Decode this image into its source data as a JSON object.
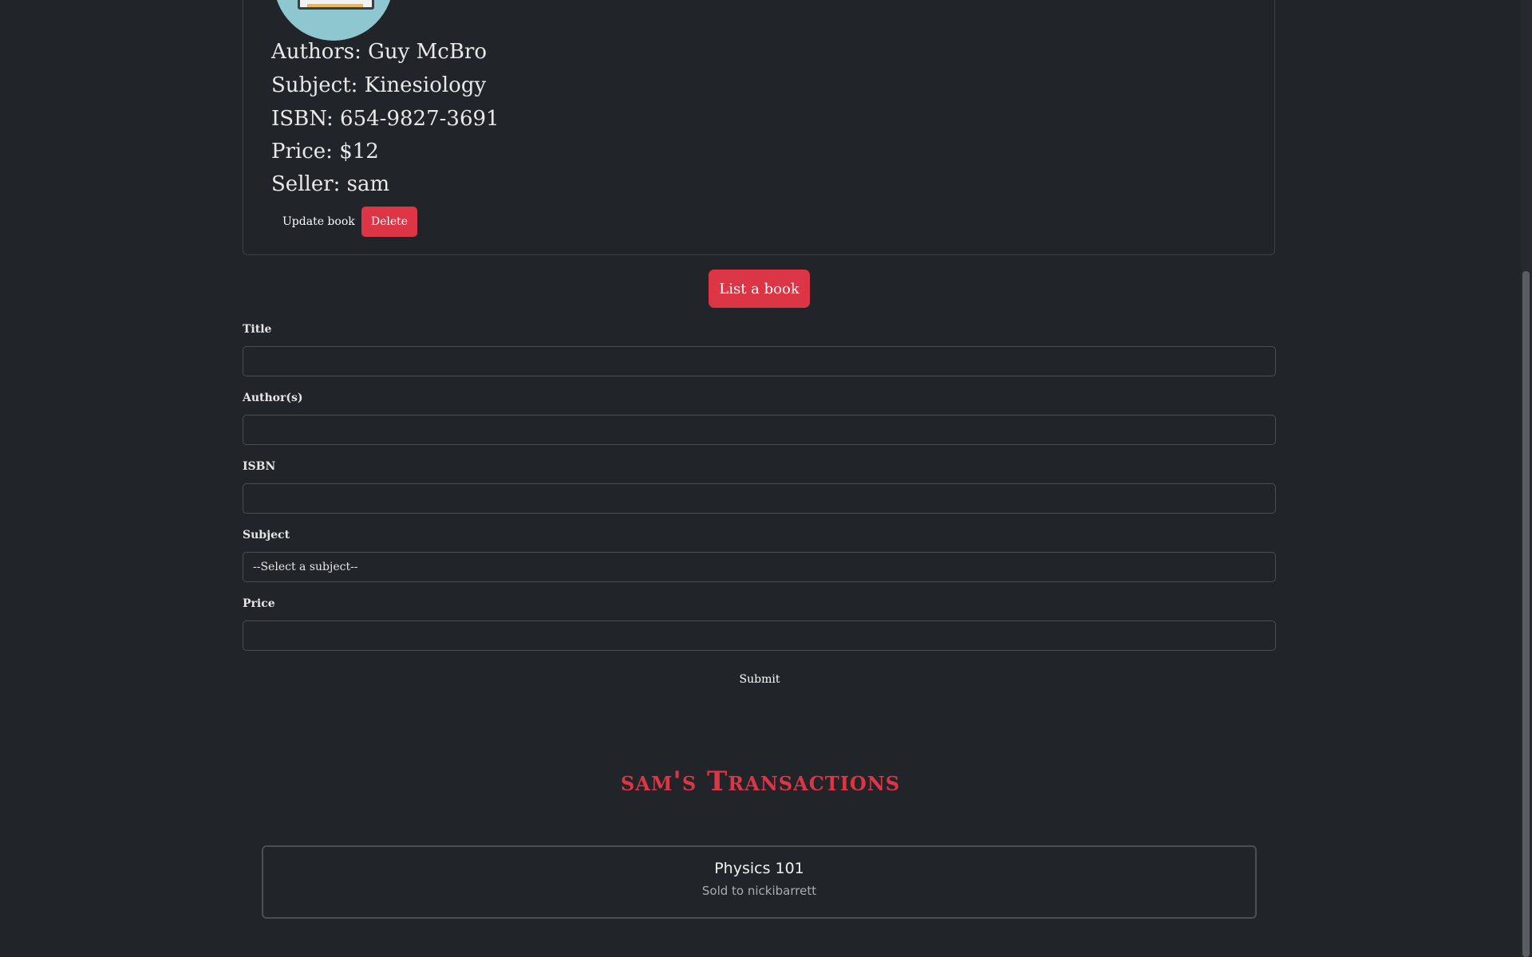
{
  "book": {
    "authors": "Authors: Guy McBro",
    "subject": "Subject: Kinesiology",
    "isbn": "ISBN: 654-9827-3691",
    "price": "Price: $12",
    "seller": "Seller: sam",
    "update_label": "Update book",
    "delete_label": "Delete"
  },
  "list_button_label": "List a book",
  "form": {
    "title_label": "Title",
    "title_value": "",
    "authors_label": "Author(s)",
    "authors_value": "",
    "isbn_label": "ISBN",
    "isbn_value": "",
    "subject_label": "Subject",
    "subject_selected": "--Select a subject--",
    "price_label": "Price",
    "price_value": "",
    "submit_label": "Submit"
  },
  "transactions": {
    "heading": "sam's Transactions",
    "items": [
      {
        "title": "Physics 101",
        "status": "Sold to nickibarrett"
      }
    ]
  },
  "colors": {
    "background": "#212429",
    "accent": "#dc3545",
    "text": "#e6e6e6",
    "muted": "#a9adb3",
    "cover": "#8ec7cf"
  },
  "icons": {
    "cover": "book-cover-icon"
  }
}
